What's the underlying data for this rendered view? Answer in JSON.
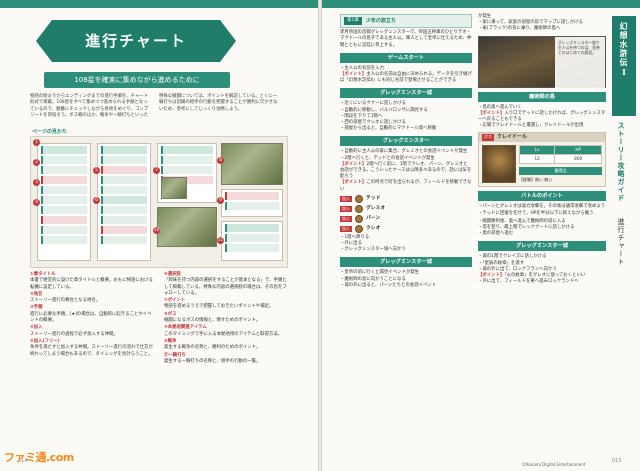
{
  "left": {
    "chapter_title": "進行チャート",
    "subtitle": "108星を確実に集めながら進めるために",
    "intro": "物語の始まりからエンディングまでの進行手順を、チャート形式で掲載。108星をすべて集めつつ進められる手順となっているので、順番にチェックしながら各地をめぐり、コンプリートを目指そう。ボス戦のほか、戦争や一騎打ちといった特殊な戦闘については、ポイントを解説している。とくに一騎打ちは因縁の相手の行動を把握することが勝利に欠かせないため、参考にしてじっくり攻略しよう。",
    "legend_head": "ページの見かた",
    "legend_items": [
      {
        "num": "①",
        "title": "章タイトル",
        "text": "本書で便宜的に設けた章タイトルと概要。おもに物語における転機に設定している。"
      },
      {
        "num": "②",
        "title": "地名",
        "text": "ストーリー進行の舞台となる地名。"
      },
      {
        "num": "③",
        "title": "手順",
        "text": "進行に必要な手順。[★]の場合は、自動的に起きることやイベントの概要。"
      },
      {
        "num": "④",
        "title": "加入",
        "text": "ストーリー進行の過程で必ず加入する仲間。"
      },
      {
        "num": "⑤",
        "title": "加入(フリー)",
        "text": "条件を満たすと加入する仲間。ストーリー進行の流れで仕方が終わってしまう場合もあるので、タイミングを見計らうこと。"
      },
      {
        "num": "⑥",
        "title": "選択肢",
        "text": "「興味を持つ内容の選択をすることが基本となる」で、手順として掲載している。特殊な内容の選択肢の場合は、その旨をフォローしている。"
      },
      {
        "num": "⑦",
        "title": "ポイント",
        "text": "物語を進めるうえで把握しておきたいポイントや補足。"
      },
      {
        "num": "⑧",
        "title": "ボス",
        "text": "戦闘になるボスの情報と、倒すためのポイント。"
      },
      {
        "num": "⑨",
        "title": "本拠地関連アイテム",
        "text": "このタイミングで手に入る本拠地用のアイテムと取得方法。"
      },
      {
        "num": "⑩",
        "title": "戦争",
        "text": "発生する戦争の名称と、勝利のためのポイント。"
      },
      {
        "num": "⑪",
        "title": "一騎打ち",
        "text": "発生する一騎打ちの名称と、相手の行動の一覧。"
      }
    ],
    "page_number": "014",
    "watermark": "ファミ通.com"
  },
  "right": {
    "side_title": "幻想水滸伝Ⅰ",
    "side_guide": "ストーリー攻略ガイド",
    "side_chart": "進行チャート",
    "chapter": {
      "tag": "第1章",
      "name": "少年の旅立ち"
    },
    "chapter_summary": "赤月帝国の首都グレッグミンスターで、帝国五将軍のひとりテオ・マクドールの息子である主人公。軍人として皇帝に仕えるため、仲間とともに宮廷に参上する。",
    "sections_a": [
      {
        "title": "ゲームスタート",
        "lines": [
          "・主人公の名前を入力",
          "【ポイント】主人公の名前は自由に決められる。データを引き継げば「幻想水滸伝Ⅱ」にも同じ名前で登場させることができる"
        ]
      },
      {
        "title": "グレッグミンスター城",
        "lines": [
          "・近くにいるクナーに話しかける",
          "・自動的に移動し、バルバロッサに謁見する",
          "・階段を下りて1階へ",
          "・西の部屋でクレオに話しかける",
          "・部屋から出ると、自動的にマクドール邸へ移動"
        ]
      },
      {
        "title": "グレッグミンスター",
        "lines": [
          "・自動的に主人公の家に集合、グレミオとの会話イベントが発生",
          "・2階へ行くと、テッドとの会話イベントが発生",
          "【ポイント】2階へ行く前に、1階でクレオ、パーン、グレミオと会話ができる。こういったケースは以降多々あるので、話には気を配ろう",
          "【ポイント】この時点で町を出られるが、フィールドを移動できない"
        ]
      }
    ],
    "party": [
      {
        "tag": "加入",
        "name": "テッド"
      },
      {
        "tag": "加入",
        "name": "グレミオ"
      },
      {
        "tag": "加入",
        "name": "パーン"
      },
      {
        "tag": "加入",
        "name": "クレオ"
      }
    ],
    "sections_a_tail": [
      "・1階へ降りる",
      "・外に出る",
      "・グレッグミンスター城へ向かう"
    ],
    "section_castle2": {
      "title": "グレッグミンスター城",
      "lines": [
        "・皇帝の前に行くと謁見イベントが発生",
        "・魔術師の島に向かうことになる",
        "・城の外に出ると、パーンたちとの会話イベント"
      ]
    },
    "col_b_top": [
      "が発生",
      "・家に帰って、家族の部屋の前でマップに話しかける",
      "・竜(ブラック)の背に乗り、魔術師の島へ"
    ],
    "shot_caption": "グレッグミンスター城で主人公を待つのは、皇帝とのはじめての謁見。",
    "section_island": {
      "title": "魔術師の島",
      "lines": [
        "・島の奥へ進んでいく",
        "【ポイント】入り口でテッドに話しかければ、グレッグミンスターへ戻ることもできる",
        "・広場でクレイドールと遭遇し、クレイドールが出現"
      ]
    },
    "boss": {
      "tag": "ボス",
      "name": "クレイドール",
      "lv_label": "Lv",
      "hp_label": "HP",
      "lv": "12",
      "hp": "800",
      "drop_label": "獲得品",
      "drops": "【経験】無い 無い"
    },
    "section_battle": {
      "title": "バトルのポイント",
      "lines": [
        "・パーンとグレミオは協力攻撃を。その後は通常攻撃で攻めよう",
        "・テッドに回復を任せて、HPを半分以下に抑えながら戦う"
      ]
    },
    "col_b_mid": [
      "・戦闘勝利後、奥へ進んで魔術師の塔に入る",
      "・塔を登り、最上階でレックナートに話しかける",
      "・奥の部屋へ進む"
    ],
    "section_castle3": {
      "title": "グレッグミンスター城",
      "lines": [
        "・城の1階でクレイズに話しかける",
        "・「星辰の紋章」を渡す",
        "・城の外に出て、ロックフランへ向かう",
        "【ポイント】「火の紋章」をグレオに使っておくといい",
        "・外に出て、フィールドを東へ進みロックランドへ"
      ]
    },
    "page_number": "015",
    "copyright": "©Konami Digital Entertainment"
  }
}
